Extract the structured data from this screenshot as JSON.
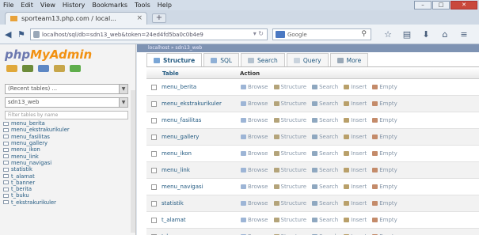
{
  "menu": [
    "File",
    "Edit",
    "View",
    "History",
    "Bookmarks",
    "Tools",
    "Help"
  ],
  "browser": {
    "tab_title": "sporteam13.php.com / local...",
    "url": "localhost/sql/db=sdn13_web&token=24ed4fd5ba0c0b4e9",
    "search_placeholder": "Google"
  },
  "left": {
    "combo_recent": "(Recent tables) ...",
    "combo_db": "sdn13_web",
    "filter_placeholder": "Filter tables by name",
    "tables": [
      "menu_berita",
      "menu_ekstrakurikuler",
      "menu_fasilitas",
      "menu_gallery",
      "menu_ikon",
      "menu_link",
      "menu_navigasi",
      "statistik",
      "t_alamat",
      "t_banner",
      "t_berita",
      "t_buku",
      "t_ekstrakurikuler"
    ]
  },
  "main": {
    "breadcrumb": "localhost » sdn13_web",
    "tabs": [
      "Structure",
      "SQL",
      "Search",
      "Query",
      "More"
    ],
    "col_table": "Table",
    "col_action": "Action",
    "rows": [
      "menu_berita",
      "menu_ekstrakurikuler",
      "menu_fasilitas",
      "menu_gallery",
      "menu_ikon",
      "menu_link",
      "menu_navigasi",
      "statistik",
      "t_alamat",
      "t_banner"
    ],
    "actions": [
      "Browse",
      "Structure",
      "Search",
      "Insert",
      "Empty"
    ]
  }
}
